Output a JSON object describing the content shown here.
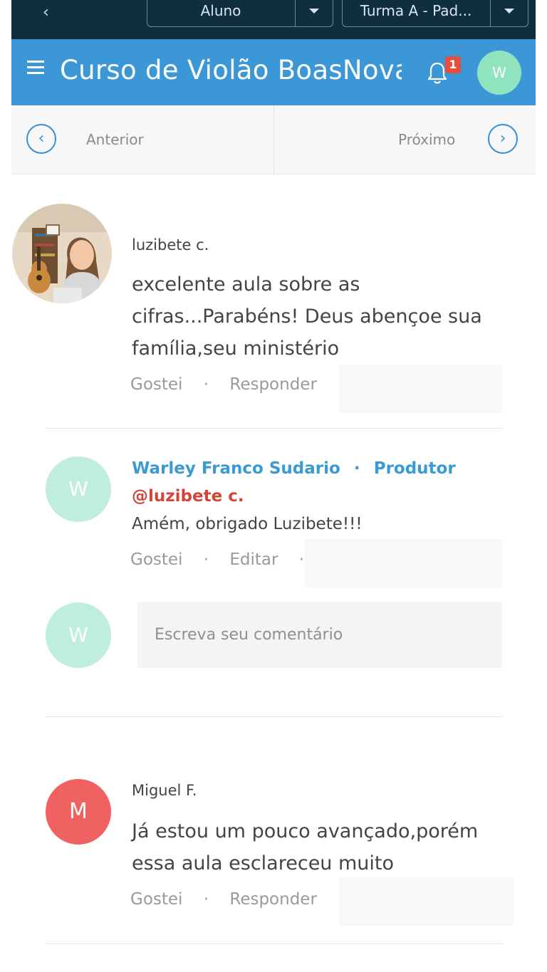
{
  "topbar": {
    "back_icon": "chevron-left-icon",
    "role_select": "Aluno",
    "class_select": "Turma A - Pad..."
  },
  "header": {
    "course_title": "Curso de Violão BoasNova",
    "notification_count": "1",
    "user_initial": "W",
    "accent_color": "#3b97d6"
  },
  "nav": {
    "previous_label": "Anterior",
    "next_label": "Próximo"
  },
  "comments": [
    {
      "author": "luzibete c.",
      "text_lines": [
        "excelente aula sobre as",
        "cifras...Parabéns! Deus abençoe sua",
        "família,seu ministério"
      ],
      "like_label": "Gostei",
      "reply_label": "Responder",
      "reply": {
        "author": "Warley Franco Sudario",
        "role": "Produtor",
        "initial": "W",
        "mention": "@luzibete c.",
        "text": "Amém, obrigado Luzibete!!!",
        "like_label": "Gostei",
        "edit_label": "Editar"
      }
    },
    {
      "author": "Miguel F.",
      "initial": "M",
      "text_lines": [
        "Já estou um pouco avançado,porém",
        "essa aula esclareceu muito"
      ],
      "like_label": "Gostei",
      "reply_label": "Responder"
    }
  ],
  "composer": {
    "initial": "W",
    "placeholder": "Escreva seu comentário"
  },
  "separator": "·"
}
